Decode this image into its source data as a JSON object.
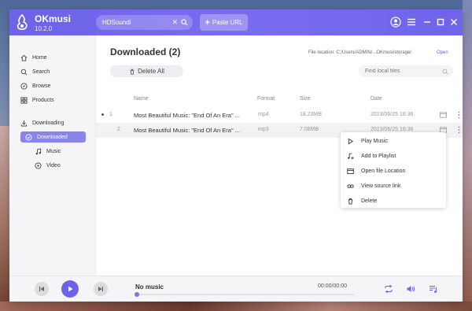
{
  "app": {
    "name": "OKmusi",
    "version": "10.2.0"
  },
  "titlebar": {
    "search_value": "HDSoundi",
    "clear_glyph": "✕",
    "paste_label": "Paste URL",
    "icons": [
      "search-icon",
      "user-icon",
      "menu-icon",
      "minimize-icon",
      "maximize-icon",
      "close-icon"
    ]
  },
  "sidebar": {
    "items": [
      {
        "label": "Home",
        "icon": "home-icon"
      },
      {
        "label": "Search",
        "icon": "search-icon"
      },
      {
        "label": "Browse",
        "icon": "browse-icon"
      },
      {
        "label": "Products",
        "icon": "products-icon"
      }
    ],
    "downloads": [
      {
        "label": "Downloading",
        "icon": "download-icon"
      },
      {
        "label": "Downloaded",
        "icon": "check-circle-icon",
        "active": true
      }
    ],
    "subs": [
      {
        "label": "Music",
        "icon": "music-note-icon"
      },
      {
        "label": "Video",
        "icon": "video-play-icon"
      }
    ]
  },
  "main": {
    "title": "Downloaded (2)",
    "file_location": "File location: C:/Users/ADMIN/...OKmusi/storage/",
    "open_label": "Open",
    "delete_all_label": "Delete All",
    "find_placeholder": "Find local files",
    "columns": {
      "name": "Name",
      "format": "Format",
      "size": "Size",
      "date": "Date"
    },
    "rows": [
      {
        "index": "1",
        "name": "Most Beautiful Music: \"End Of An Era\" ...",
        "format": "mp4",
        "size": "18.23MB",
        "date": "2023/06/25 16:36"
      },
      {
        "index": "2",
        "name": "Most Beautiful Music: \"End Of An Era\" ...",
        "format": "mp3",
        "size": "7.08MB",
        "date": "2023/06/25 16:36"
      }
    ]
  },
  "context_menu": {
    "items": [
      {
        "label": "Play Music",
        "icon": "play-icon"
      },
      {
        "label": "Add to Playlist",
        "icon": "add-playlist-icon"
      },
      {
        "label": "Open file Location",
        "icon": "folder-icon"
      },
      {
        "label": "View source link",
        "icon": "link-icon"
      },
      {
        "label": "Delete",
        "icon": "trash-icon"
      }
    ]
  },
  "player": {
    "track": "No music",
    "time": "00:00/00:00",
    "progress": 0,
    "accent": "#6c63e6"
  }
}
